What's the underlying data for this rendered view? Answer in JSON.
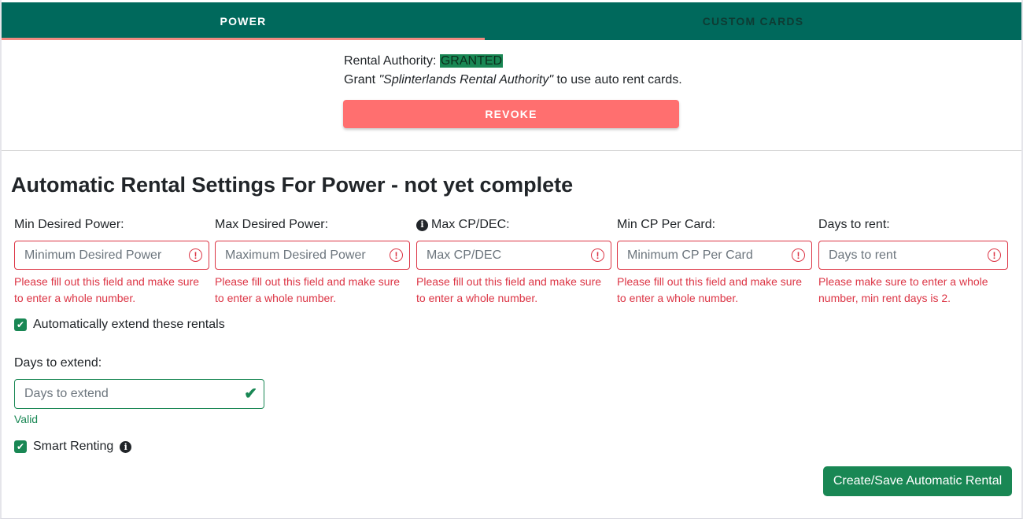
{
  "tabs": [
    {
      "label": "POWER",
      "active": true
    },
    {
      "label": "CUSTOM CARDS",
      "active": false
    }
  ],
  "authority": {
    "label": "Rental Authority:",
    "status": "GRANTED",
    "grant_prefix": "Grant ",
    "grant_name": "\"Splinterlands Rental Authority\"",
    "grant_suffix": " to use auto rent cards.",
    "revoke_label": "REVOKE"
  },
  "section_title": "Automatic Rental Settings For Power - not yet complete",
  "fields": [
    {
      "label": "Min Desired Power:",
      "placeholder": "Minimum Desired Power",
      "feedback": "Please fill out this field and make sure to enter a whole number."
    },
    {
      "label": "Max Desired Power:",
      "placeholder": "Maximum Desired Power",
      "feedback": "Please fill out this field and make sure to enter a whole number."
    },
    {
      "label": "Max CP/DEC:",
      "placeholder": "Max CP/DEC",
      "feedback": "Please fill out this field and make sure to enter a whole number."
    },
    {
      "label": "Min CP Per Card:",
      "placeholder": "Minimum CP Per Card",
      "feedback": "Please fill out this field and make sure to enter a whole number."
    },
    {
      "label": "Days to rent:",
      "placeholder": "Days to rent",
      "feedback": "Please make sure to enter a whole number, min rent days is 2."
    }
  ],
  "auto_extend": {
    "label": "Automatically extend these rentals",
    "checked": true
  },
  "days_extend": {
    "label": "Days to extend:",
    "placeholder": "Days to extend",
    "feedback": "Valid"
  },
  "smart_renting": {
    "label": "Smart Renting",
    "checked": true
  },
  "save_label": "Create/Save Automatic Rental",
  "colors": {
    "header": "#00695c",
    "tab_indicator": "#ef8a80",
    "danger": "#dc3545",
    "success": "#198754",
    "revoke": "#ff6f6f"
  },
  "icons": {
    "error": "exclamation-circle-icon",
    "valid": "check-icon",
    "info": "info-circle-icon",
    "checkbox": "checkmark-icon"
  }
}
